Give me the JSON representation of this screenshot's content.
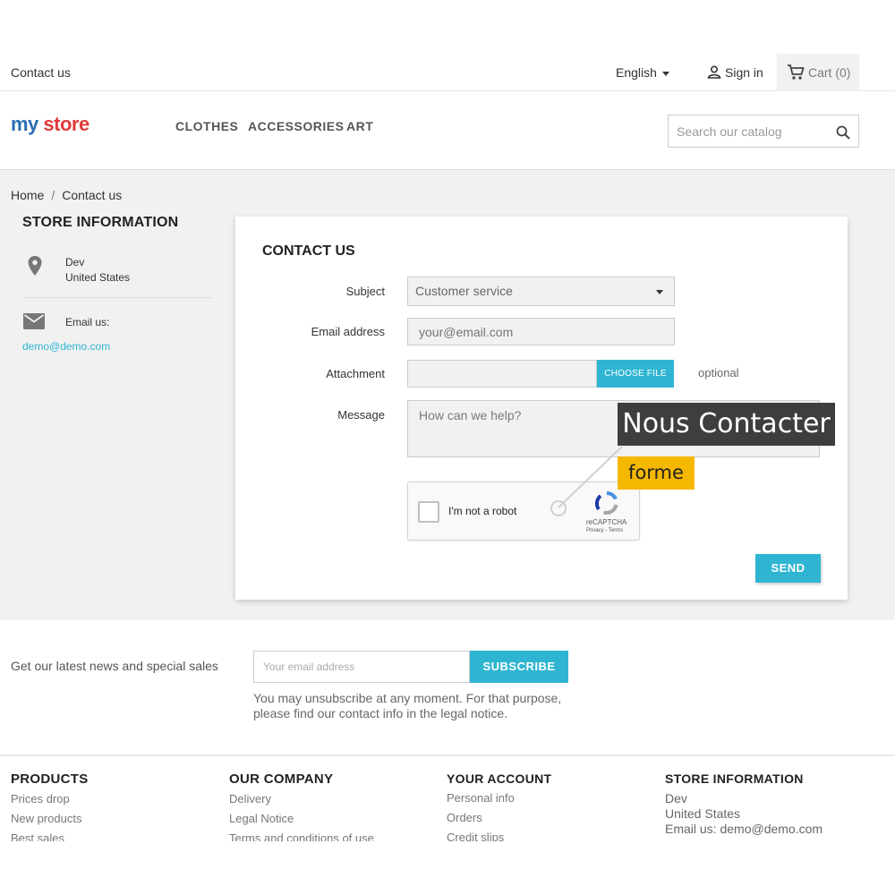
{
  "topbar": {
    "contact_link": "Contact us",
    "language": "English",
    "signin": "Sign in",
    "cart": "Cart (0)"
  },
  "header": {
    "logo_part1": "my",
    "logo_part2": "store",
    "nav": [
      "CLOTHES",
      "ACCESSORIES",
      "ART"
    ],
    "search_placeholder": "Search our catalog"
  },
  "breadcrumb": {
    "home": "Home",
    "separator": "/",
    "current": "Contact us"
  },
  "store_info": {
    "title": "STORE INFORMATION",
    "address_line1": "Dev",
    "address_line2": "United States",
    "email_label": "Email us:",
    "email": "demo@demo.com"
  },
  "contact_form": {
    "title": "CONTACT US",
    "subject_label": "Subject",
    "subject_value": "Customer service",
    "email_label": "Email address",
    "email_placeholder": "your@email.com",
    "attachment_label": "Attachment",
    "choose_file": "CHOOSE FILE",
    "optional": "optional",
    "message_label": "Message",
    "message_placeholder": "How can we help?",
    "captcha_text": "I'm not a robot",
    "captcha_brand": "reCAPTCHA",
    "captcha_terms": "Privacy - Terms",
    "send": "SEND"
  },
  "overlay": {
    "title": "Nous Contacter",
    "subtitle": "forme"
  },
  "newsletter": {
    "text": "Get our latest news and special sales",
    "placeholder": "Your email address",
    "subscribe": "SUBSCRIBE",
    "note": "You may unsubscribe at any moment. For that purpose, please find our contact info in the legal notice."
  },
  "footer": {
    "products": {
      "title": "PRODUCTS",
      "items": [
        "Prices drop",
        "New products",
        "Best sales"
      ]
    },
    "company": {
      "title": "OUR COMPANY",
      "items": [
        "Delivery",
        "Legal Notice",
        "Terms and conditions of use"
      ]
    },
    "account": {
      "title": "YOUR ACCOUNT",
      "items": [
        "Personal info",
        "Orders",
        "Credit slips"
      ]
    },
    "store": {
      "title": "STORE INFORMATION",
      "line1": "Dev",
      "line2": "United States",
      "line3": "Email us: demo@demo.com"
    }
  },
  "colors": {
    "accent": "#2fb5d2",
    "badge_dark": "#3e3e3e",
    "badge_yellow": "#f5b800"
  }
}
